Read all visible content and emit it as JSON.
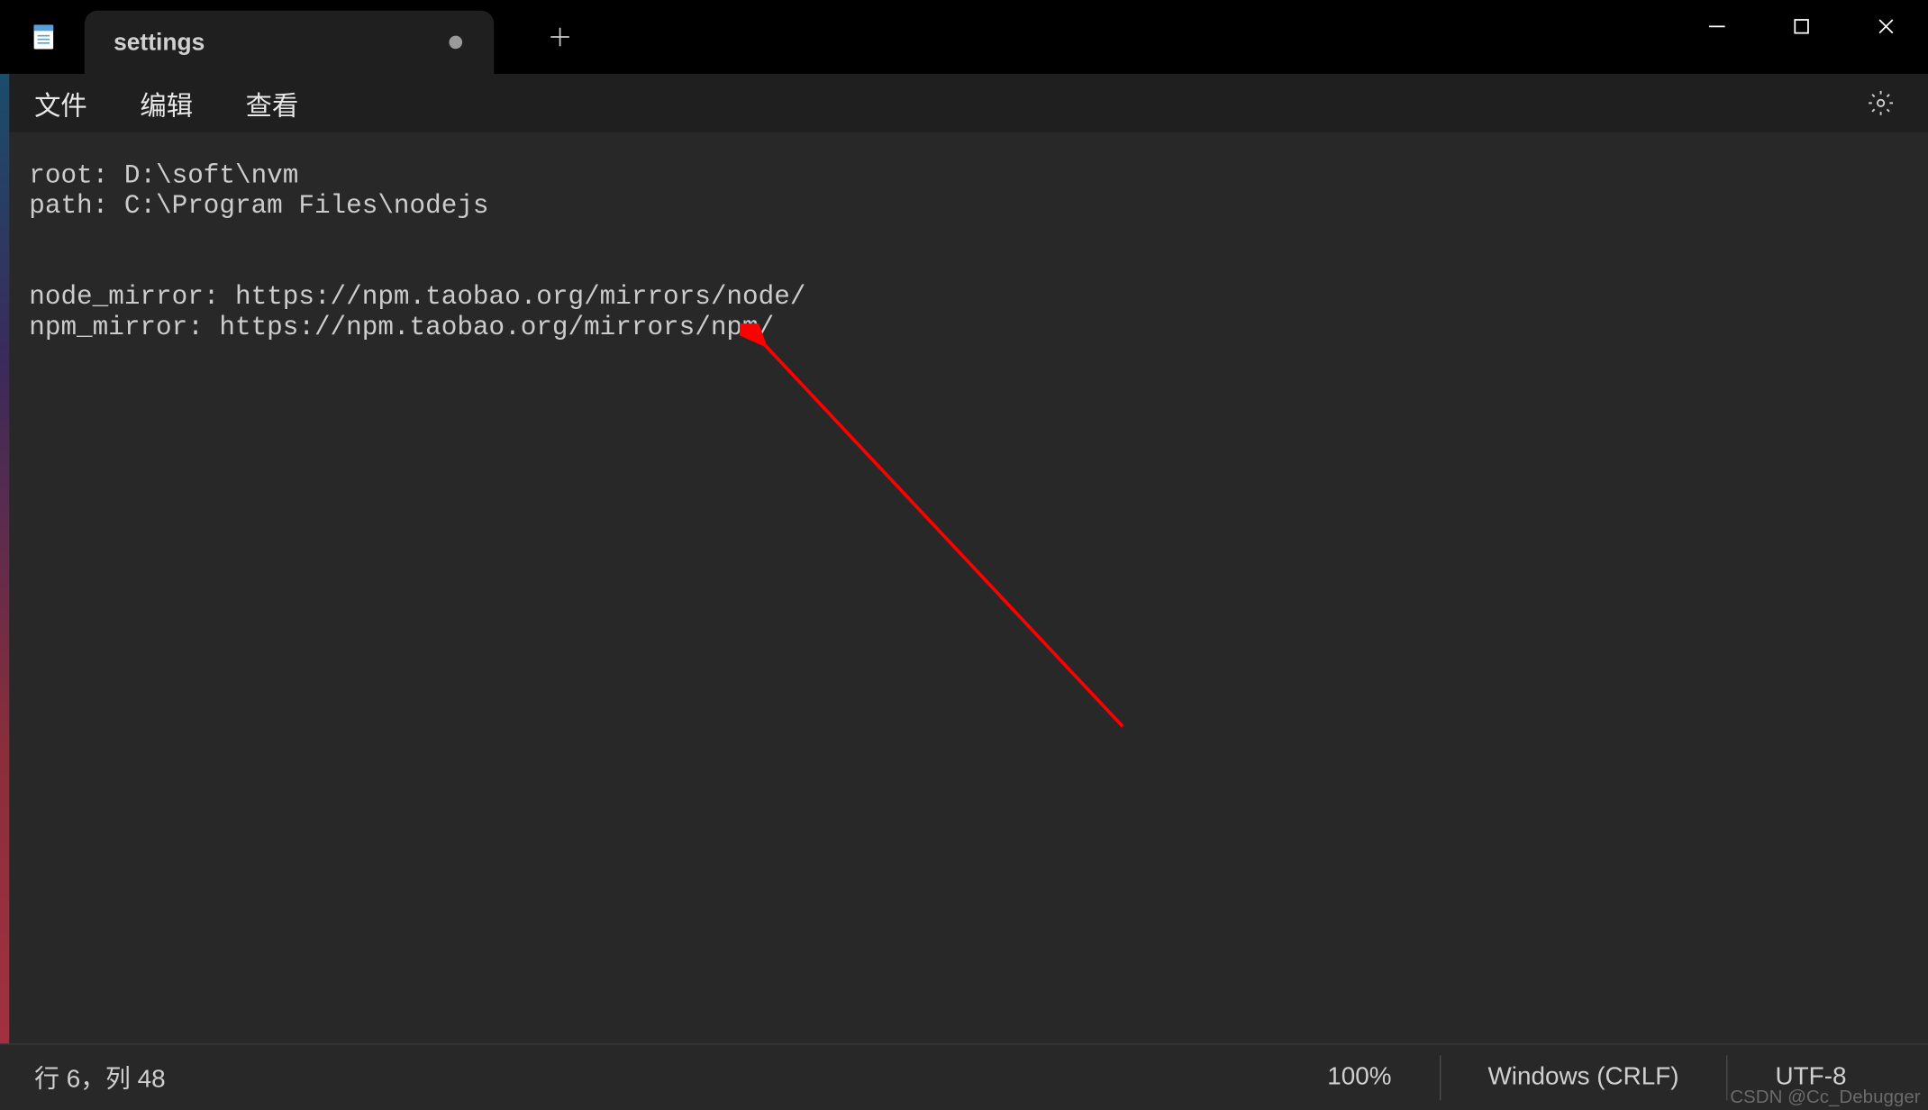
{
  "tab": {
    "title": "settings",
    "modified": true
  },
  "menu": {
    "file": "文件",
    "edit": "编辑",
    "view": "查看"
  },
  "editor": {
    "content": "root: D:\\soft\\nvm\npath: C:\\Program Files\\nodejs\n\n\nnode_mirror: https://npm.taobao.org/mirrors/node/\nnpm_mirror: https://npm.taobao.org/mirrors/npm/"
  },
  "status": {
    "position": "行 6，列 48",
    "zoom": "100%",
    "lineEnding": "Windows (CRLF)",
    "encoding": "UTF-8"
  },
  "watermark": "CSDN @Cc_Debugger",
  "annotation": {
    "color": "#ff0000"
  }
}
